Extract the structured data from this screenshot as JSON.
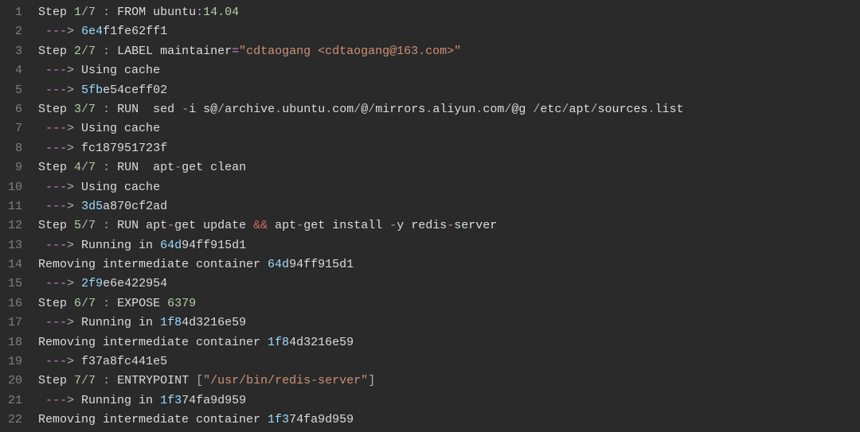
{
  "lines": [
    {
      "n": "1",
      "tokens": [
        [
          "tk-default",
          "Step "
        ],
        [
          "tk-num",
          "1"
        ],
        [
          "tk-punct",
          "/"
        ],
        [
          "tk-num",
          "7"
        ],
        [
          "tk-default",
          " "
        ],
        [
          "tk-punct",
          ":"
        ],
        [
          "tk-default",
          " FROM ubuntu"
        ],
        [
          "tk-punct",
          ":"
        ],
        [
          "tk-num",
          "14.04"
        ]
      ]
    },
    {
      "n": "2",
      "tokens": [
        [
          "tk-dim",
          " "
        ],
        [
          "tk-arrow",
          "---"
        ],
        [
          "tk-punct",
          ">"
        ],
        [
          "tk-default",
          " "
        ],
        [
          "tk-hash",
          "6e4"
        ],
        [
          "tk-default",
          "f1fe62ff1"
        ]
      ]
    },
    {
      "n": "3",
      "tokens": [
        [
          "tk-default",
          "Step "
        ],
        [
          "tk-num",
          "2"
        ],
        [
          "tk-punct",
          "/"
        ],
        [
          "tk-num",
          "7"
        ],
        [
          "tk-default",
          " "
        ],
        [
          "tk-punct",
          ":"
        ],
        [
          "tk-default",
          " LABEL maintainer"
        ],
        [
          "tk-arrow",
          "="
        ],
        [
          "tk-str",
          "\"cdtaogang <cdtaogang@163.com>\""
        ]
      ]
    },
    {
      "n": "4",
      "tokens": [
        [
          "tk-dim",
          " "
        ],
        [
          "tk-arrow",
          "---"
        ],
        [
          "tk-punct",
          ">"
        ],
        [
          "tk-default",
          " Using cache"
        ]
      ]
    },
    {
      "n": "5",
      "tokens": [
        [
          "tk-dim",
          " "
        ],
        [
          "tk-arrow",
          "---"
        ],
        [
          "tk-punct",
          ">"
        ],
        [
          "tk-default",
          " "
        ],
        [
          "tk-hash",
          "5fb"
        ],
        [
          "tk-default",
          "e54ceff02"
        ]
      ]
    },
    {
      "n": "6",
      "tokens": [
        [
          "tk-default",
          "Step "
        ],
        [
          "tk-num",
          "3"
        ],
        [
          "tk-punct",
          "/"
        ],
        [
          "tk-num",
          "7"
        ],
        [
          "tk-default",
          " "
        ],
        [
          "tk-punct",
          ":"
        ],
        [
          "tk-default",
          " RUN  sed "
        ],
        [
          "tk-arrow",
          "-"
        ],
        [
          "tk-default",
          "i s@"
        ],
        [
          "tk-punct",
          "/"
        ],
        [
          "tk-default",
          "archive"
        ],
        [
          "tk-punct",
          "."
        ],
        [
          "tk-default",
          "ubuntu"
        ],
        [
          "tk-punct",
          "."
        ],
        [
          "tk-default",
          "com"
        ],
        [
          "tk-punct",
          "/"
        ],
        [
          "tk-default",
          "@"
        ],
        [
          "tk-punct",
          "/"
        ],
        [
          "tk-default",
          "mirrors"
        ],
        [
          "tk-punct",
          "."
        ],
        [
          "tk-default",
          "aliyun"
        ],
        [
          "tk-punct",
          "."
        ],
        [
          "tk-default",
          "com"
        ],
        [
          "tk-punct",
          "/"
        ],
        [
          "tk-default",
          "@g "
        ],
        [
          "tk-punct",
          "/"
        ],
        [
          "tk-default",
          "etc"
        ],
        [
          "tk-punct",
          "/"
        ],
        [
          "tk-default",
          "apt"
        ],
        [
          "tk-punct",
          "/"
        ],
        [
          "tk-default",
          "sources"
        ],
        [
          "tk-punct",
          "."
        ],
        [
          "tk-default",
          "list"
        ]
      ]
    },
    {
      "n": "7",
      "tokens": [
        [
          "tk-dim",
          " "
        ],
        [
          "tk-arrow",
          "---"
        ],
        [
          "tk-punct",
          ">"
        ],
        [
          "tk-default",
          " Using cache"
        ]
      ]
    },
    {
      "n": "8",
      "tokens": [
        [
          "tk-dim",
          " "
        ],
        [
          "tk-arrow",
          "---"
        ],
        [
          "tk-punct",
          ">"
        ],
        [
          "tk-default",
          " fc187951723f"
        ]
      ]
    },
    {
      "n": "9",
      "tokens": [
        [
          "tk-default",
          "Step "
        ],
        [
          "tk-num",
          "4"
        ],
        [
          "tk-punct",
          "/"
        ],
        [
          "tk-num",
          "7"
        ],
        [
          "tk-default",
          " "
        ],
        [
          "tk-punct",
          ":"
        ],
        [
          "tk-default",
          " RUN  apt"
        ],
        [
          "tk-arrow",
          "-"
        ],
        [
          "tk-default",
          "get clean"
        ]
      ]
    },
    {
      "n": "10",
      "tokens": [
        [
          "tk-dim",
          " "
        ],
        [
          "tk-arrow",
          "---"
        ],
        [
          "tk-punct",
          ">"
        ],
        [
          "tk-default",
          " Using cache"
        ]
      ]
    },
    {
      "n": "11",
      "tokens": [
        [
          "tk-dim",
          " "
        ],
        [
          "tk-arrow",
          "---"
        ],
        [
          "tk-punct",
          ">"
        ],
        [
          "tk-default",
          " "
        ],
        [
          "tk-hash",
          "3d5"
        ],
        [
          "tk-default",
          "a870cf2ad"
        ]
      ]
    },
    {
      "n": "12",
      "tokens": [
        [
          "tk-default",
          "Step "
        ],
        [
          "tk-num",
          "5"
        ],
        [
          "tk-punct",
          "/"
        ],
        [
          "tk-num",
          "7"
        ],
        [
          "tk-default",
          " "
        ],
        [
          "tk-punct",
          ":"
        ],
        [
          "tk-default",
          " RUN apt"
        ],
        [
          "tk-arrow",
          "-"
        ],
        [
          "tk-default",
          "get update "
        ],
        [
          "tk-amp",
          "&&"
        ],
        [
          "tk-default",
          " apt"
        ],
        [
          "tk-arrow",
          "-"
        ],
        [
          "tk-default",
          "get install "
        ],
        [
          "tk-arrow",
          "-"
        ],
        [
          "tk-default",
          "y redis"
        ],
        [
          "tk-arrow",
          "-"
        ],
        [
          "tk-default",
          "server"
        ]
      ]
    },
    {
      "n": "13",
      "tokens": [
        [
          "tk-dim",
          " "
        ],
        [
          "tk-arrow",
          "---"
        ],
        [
          "tk-punct",
          ">"
        ],
        [
          "tk-default",
          " Running in "
        ],
        [
          "tk-hash",
          "64d"
        ],
        [
          "tk-default",
          "94ff915d1"
        ]
      ]
    },
    {
      "n": "14",
      "tokens": [
        [
          "tk-default",
          "Removing intermediate container "
        ],
        [
          "tk-hash",
          "64d"
        ],
        [
          "tk-default",
          "94ff915d1"
        ]
      ]
    },
    {
      "n": "15",
      "tokens": [
        [
          "tk-dim",
          " "
        ],
        [
          "tk-arrow",
          "---"
        ],
        [
          "tk-punct",
          ">"
        ],
        [
          "tk-default",
          " "
        ],
        [
          "tk-hash",
          "2f9"
        ],
        [
          "tk-default",
          "e6e422954"
        ]
      ]
    },
    {
      "n": "16",
      "tokens": [
        [
          "tk-default",
          "Step "
        ],
        [
          "tk-num",
          "6"
        ],
        [
          "tk-punct",
          "/"
        ],
        [
          "tk-num",
          "7"
        ],
        [
          "tk-default",
          " "
        ],
        [
          "tk-punct",
          ":"
        ],
        [
          "tk-default",
          " EXPOSE "
        ],
        [
          "tk-num",
          "6379"
        ]
      ]
    },
    {
      "n": "17",
      "tokens": [
        [
          "tk-dim",
          " "
        ],
        [
          "tk-arrow",
          "---"
        ],
        [
          "tk-punct",
          ">"
        ],
        [
          "tk-default",
          " Running in "
        ],
        [
          "tk-hash",
          "1f8"
        ],
        [
          "tk-default",
          "4d3216e59"
        ]
      ]
    },
    {
      "n": "18",
      "tokens": [
        [
          "tk-default",
          "Removing intermediate container "
        ],
        [
          "tk-hash",
          "1f8"
        ],
        [
          "tk-default",
          "4d3216e59"
        ]
      ]
    },
    {
      "n": "19",
      "tokens": [
        [
          "tk-dim",
          " "
        ],
        [
          "tk-arrow",
          "---"
        ],
        [
          "tk-punct",
          ">"
        ],
        [
          "tk-default",
          " f37a8fc441e5"
        ]
      ]
    },
    {
      "n": "20",
      "tokens": [
        [
          "tk-default",
          "Step "
        ],
        [
          "tk-num",
          "7"
        ],
        [
          "tk-punct",
          "/"
        ],
        [
          "tk-num",
          "7"
        ],
        [
          "tk-default",
          " "
        ],
        [
          "tk-punct",
          ":"
        ],
        [
          "tk-default",
          " ENTRYPOINT "
        ],
        [
          "tk-punct",
          "["
        ],
        [
          "tk-str",
          "\"/usr/bin/redis-server\""
        ],
        [
          "tk-punct",
          "]"
        ]
      ]
    },
    {
      "n": "21",
      "tokens": [
        [
          "tk-dim",
          " "
        ],
        [
          "tk-arrow",
          "---"
        ],
        [
          "tk-punct",
          ">"
        ],
        [
          "tk-default",
          " Running in "
        ],
        [
          "tk-hash",
          "1f3"
        ],
        [
          "tk-default",
          "74fa9d959"
        ]
      ]
    },
    {
      "n": "22",
      "tokens": [
        [
          "tk-default",
          "Removing intermediate container "
        ],
        [
          "tk-hash",
          "1f3"
        ],
        [
          "tk-default",
          "74fa9d959"
        ]
      ]
    }
  ]
}
